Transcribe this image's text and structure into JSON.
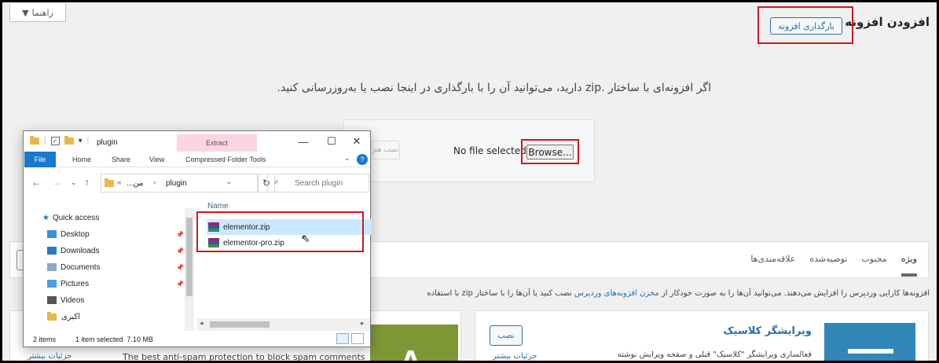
{
  "wp": {
    "help_label": "راهنما",
    "page_title": "افزودن افزونه",
    "upload_button": "بارگذاری افزونه",
    "info_text": "اگر افزونه‌ای با ساختار .zip دارید، می‌توانید آن را با بارگذاری در اینجا نصب یا به‌روزرسانی کنید.",
    "install_now_disabled": "نصب هم",
    "no_file": "No file selected.",
    "browse": "Browse...",
    "tabs": [
      "ویژه",
      "محبوب",
      "توصیه‌شده",
      "علاقه‌مندی‌ها"
    ],
    "desc_prefix": "افزونه‌ها کارایی وردپرس را افزایش می‌دهند. می‌توانید آن‌ها را به صورت خودکار از ",
    "desc_link": "مخزن افزونه‌های وردپرس",
    "desc_suffix": " نصب کنید یا آن‌ها را با ساختار zip با استفاده",
    "card1_title": "ویرایشگر کلاسیک",
    "card1_install": "نصب",
    "card1_desc": "فعالسازی ویرایشگر \"کلاسیک\" قبلی و صفحه ویرایش نوشته",
    "card1_more": "جزئیات بیشتر",
    "card2_letter": "A",
    "card2_desc": "The best anti-spam protection to block spam comments",
    "card2_more": "جزئیات بیشتر"
  },
  "explorer": {
    "title": "plugin",
    "contextual_tab": "Extract",
    "ribbon_tabs": {
      "file": "File",
      "home": "Home",
      "share": "Share",
      "view": "View",
      "tools": "Compressed Folder Tools"
    },
    "path_parent": "...من",
    "path_current": "plugin",
    "search_placeholder": "Search plugin",
    "column_name": "Name",
    "nav_items": [
      {
        "label": "Quick access",
        "color": "#1979ca"
      },
      {
        "label": "Desktop",
        "color": "#3a8fd9"
      },
      {
        "label": "Downloads",
        "color": "#2b79c4"
      },
      {
        "label": "Documents",
        "color": "#8aa8c8"
      },
      {
        "label": "Pictures",
        "color": "#4aa0e0"
      },
      {
        "label": "Videos",
        "color": "#555555"
      },
      {
        "label": "اکبری",
        "color": "#e8b84a"
      }
    ],
    "files": [
      "elementor.zip",
      "elementor-pro.zip"
    ],
    "status_items": "2 items",
    "status_selected": "1 item selected  7.10 MB"
  },
  "colors": {
    "accent_blue": "#2271b1",
    "highlight_red": "#d0181c",
    "win_blue": "#1979ca"
  }
}
